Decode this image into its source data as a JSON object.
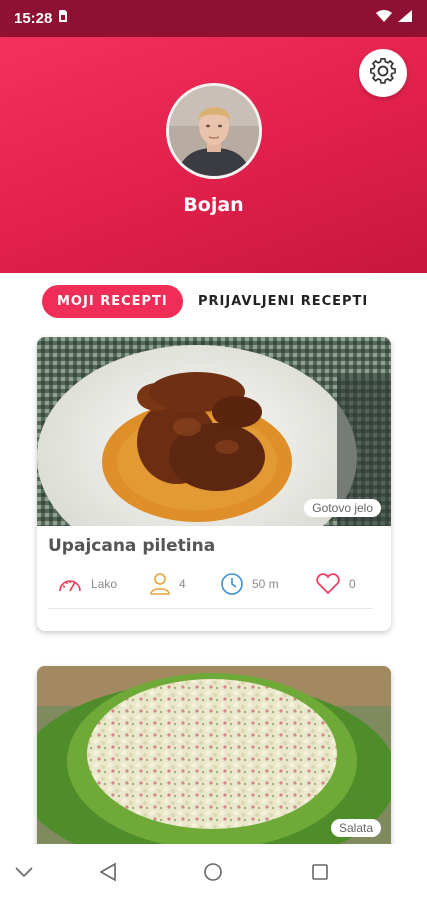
{
  "status_bar": {
    "time": "15:28",
    "icons": [
      "sim-card-icon",
      "wifi-icon",
      "signal-icon"
    ]
  },
  "header": {
    "settings_icon": "gear-icon",
    "user_name": "Bojan",
    "accent": "#ef2d57"
  },
  "tabs": [
    {
      "label": "MOJI RECEPTI",
      "active": true
    },
    {
      "label": "PRIJAVLJENI RECEPTI",
      "active": false
    }
  ],
  "recipes": [
    {
      "title": "Upajcana piletina",
      "tag": "Gotovo jelo",
      "difficulty": "Lako",
      "servings": "4",
      "time": "50 m",
      "likes": "0"
    },
    {
      "tag": "Salata"
    }
  ],
  "nav_bar": [
    "chevron-down-icon",
    "back-icon",
    "home-icon",
    "recents-icon"
  ]
}
